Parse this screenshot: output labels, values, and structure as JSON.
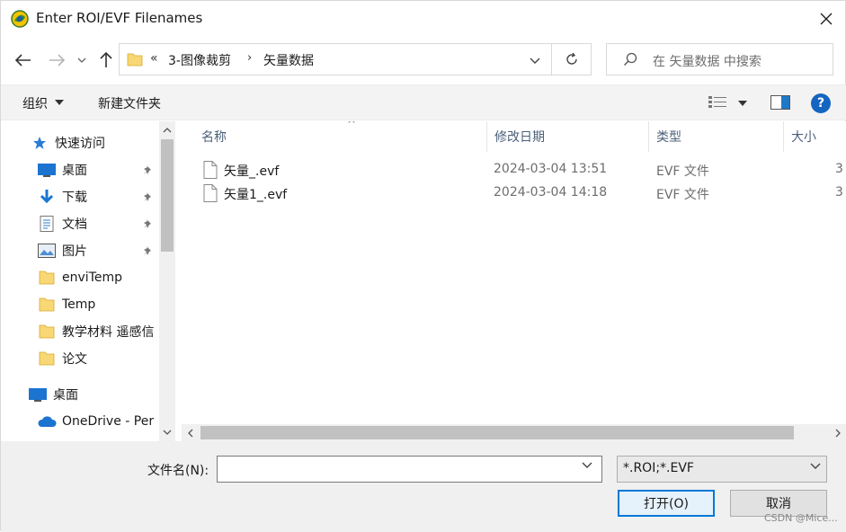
{
  "window": {
    "title": "Enter ROI/EVF Filenames"
  },
  "address": {
    "overflow": "«",
    "crumbs": [
      "3-图像裁剪",
      "矢量数据"
    ],
    "search_placeholder": "在 矢量数据 中搜索"
  },
  "toolbar": {
    "organize": "组织",
    "new_folder": "新建文件夹"
  },
  "nav": {
    "items": [
      {
        "label": "快速访问",
        "icon": "star-icon"
      },
      {
        "label": "桌面",
        "icon": "desktop-icon",
        "pinned": true
      },
      {
        "label": "下载",
        "icon": "download-icon",
        "pinned": true
      },
      {
        "label": "文档",
        "icon": "document-icon",
        "pinned": true
      },
      {
        "label": "图片",
        "icon": "picture-icon",
        "pinned": true
      },
      {
        "label": "enviTemp",
        "icon": "folder-icon"
      },
      {
        "label": "Temp",
        "icon": "folder-icon"
      },
      {
        "label": "教学材料 遥感信",
        "icon": "folder-icon"
      },
      {
        "label": "论文",
        "icon": "folder-icon"
      },
      {
        "label": "桌面",
        "icon": "desktop-icon"
      },
      {
        "label": "OneDrive - Per",
        "icon": "cloud-icon"
      }
    ]
  },
  "columns": {
    "name": "名称",
    "modified": "修改日期",
    "type": "类型",
    "size": "大小"
  },
  "files": [
    {
      "name": "矢量_.evf",
      "modified": "2024-03-04 13:51",
      "type": "EVF 文件",
      "size": "3"
    },
    {
      "name": "矢量1_.evf",
      "modified": "2024-03-04 14:18",
      "type": "EVF 文件",
      "size": "3"
    }
  ],
  "bottom": {
    "filename_label": "文件名(N):",
    "filename_value": "",
    "filter": "*.ROI;*.EVF",
    "open_label": "打开(O)",
    "cancel_label": "取消"
  },
  "watermark": "CSDN @Mice...",
  "colors": {
    "accent": "#0078d7",
    "folder": "#f8d775",
    "help": "#1565c0"
  }
}
